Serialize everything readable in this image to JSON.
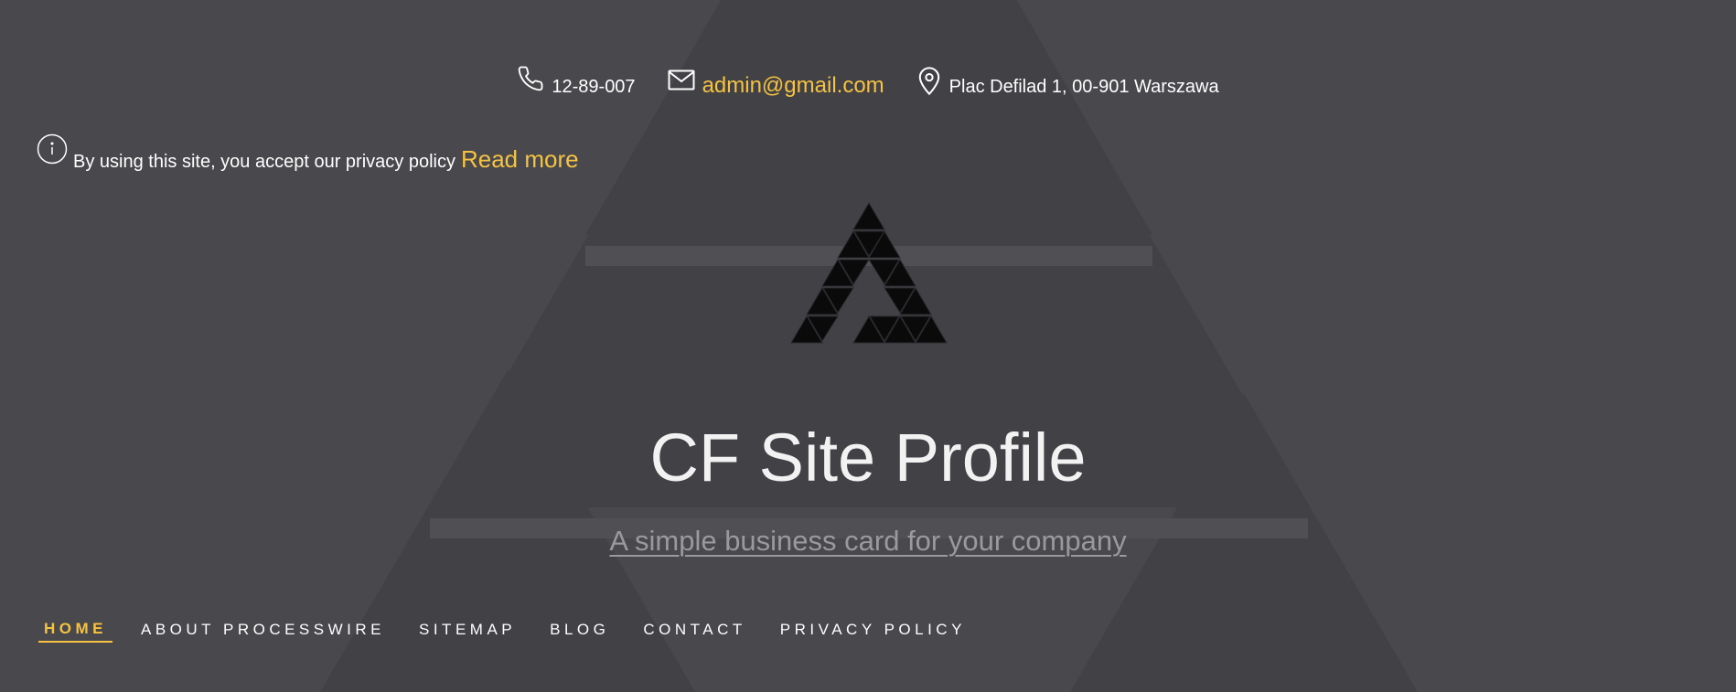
{
  "contact": {
    "phone": "12-89-007",
    "email": "admin@gmail.com",
    "address": "Plac Defilad 1, 00-901 Warszawa"
  },
  "privacy": {
    "text": "By using this site, you accept our privacy policy",
    "read_more": "Read more"
  },
  "site": {
    "title": "CF Site Profile",
    "tagline": "A simple business card for your company"
  },
  "nav": {
    "items": [
      {
        "label": "HOME",
        "active": true
      },
      {
        "label": "ABOUT PROCESSWIRE",
        "active": false
      },
      {
        "label": "SITEMAP",
        "active": false
      },
      {
        "label": "BLOG",
        "active": false
      },
      {
        "label": "CONTACT",
        "active": false
      },
      {
        "label": "PRIVACY POLICY",
        "active": false
      }
    ]
  },
  "icons": {
    "phone": "phone-icon",
    "email": "envelope-icon",
    "address": "map-pin-icon",
    "info": "info-icon",
    "logo": "triangle-logo"
  },
  "colors": {
    "background": "#48484d",
    "accent": "#f5c242",
    "text": "#ffffff",
    "tagline": "#9a9a9e"
  }
}
